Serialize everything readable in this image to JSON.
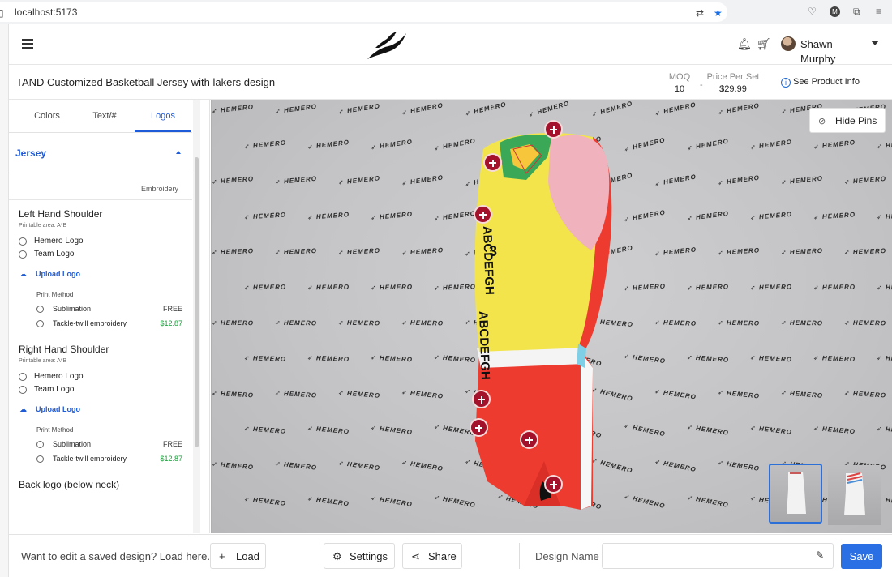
{
  "browser": {
    "url": "localhost:5173",
    "toolbar_icons": [
      "translate-icon",
      "star-icon",
      "pocket-icon",
      "profile-icon",
      "extensions-icon",
      "menu-icon"
    ],
    "profile_initial": "M"
  },
  "header": {
    "user_name": "Shawn Murphy",
    "icons": [
      "menu-icon",
      "logo",
      "bell-icon",
      "cart-icon",
      "avatar",
      "chevron-down-icon"
    ]
  },
  "product": {
    "title": "TAND Customized Basketball Jersey with lakers design",
    "moq_label": "MOQ",
    "moq_value": "10",
    "separator": "-",
    "price_label": "Price Per Set",
    "price_value": "$29.99",
    "info_link": "See Product Info"
  },
  "panel": {
    "tabs": [
      {
        "label": "Colors",
        "active": false
      },
      {
        "label": "Text/#",
        "active": false
      },
      {
        "label": "Logos",
        "active": true
      }
    ],
    "section_title": "Jersey",
    "method_label": "Embroidery",
    "groups": [
      {
        "title": "Left Hand Shoulder",
        "subtitle": "Printable area: A*B",
        "options": [
          "Hemero Logo",
          "Team Logo"
        ],
        "upload_label": "Upload Logo",
        "print_method_label": "Print Method",
        "methods": [
          {
            "label": "Sublimation",
            "price": "FREE"
          },
          {
            "label": "Tackle-twill embroidery",
            "price": "$12.87"
          }
        ]
      },
      {
        "title": "Right Hand Shoulder",
        "subtitle": "Printable area: A*B",
        "options": [
          "Hemero Logo",
          "Team Logo"
        ],
        "upload_label": "Upload Logo",
        "print_method_label": "Print Method",
        "methods": [
          {
            "label": "Sublimation",
            "price": "FREE"
          },
          {
            "label": "Tackle-twill embroidery",
            "price": "$12.87"
          }
        ]
      },
      {
        "title": "Back logo (below neck)"
      }
    ]
  },
  "viewer": {
    "hide_pins_label": "Hide Pins",
    "watermark": "HEMERO",
    "jersey_number": "3",
    "jersey_text": "ABCDEFGH",
    "colors": {
      "jersey_yellow": "#f2e44a",
      "shorts_red": "#ee3b30",
      "pin": "#a3122a",
      "trim_green": "#3aa856"
    },
    "thumbnails": [
      "front-view",
      "side-view"
    ]
  },
  "footer": {
    "edit_prompt": "Want to edit a saved design? Load here.",
    "load_label": "Load",
    "settings_label": "Settings",
    "share_label": "Share",
    "design_name_label": "Design Name",
    "design_name_value": "",
    "save_label": "Save"
  },
  "colors": {
    "accent": "#1e5bd8",
    "save_button": "#2a6fe3",
    "price_paid": "#1a9a3a"
  }
}
